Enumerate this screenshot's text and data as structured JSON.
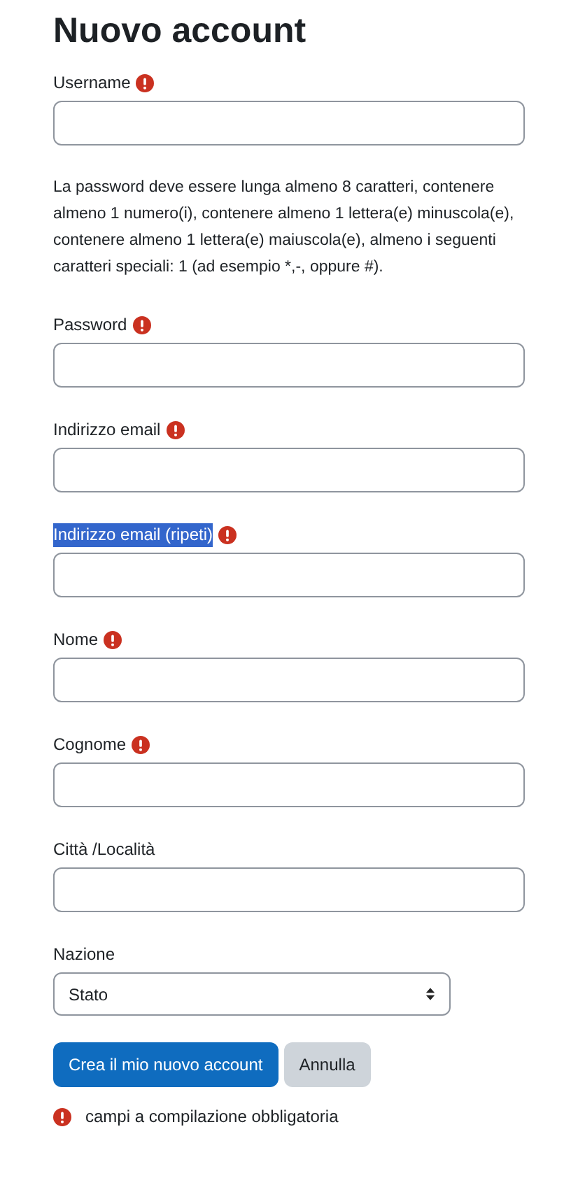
{
  "title": "Nuovo account",
  "fields": [
    {
      "kind": "text",
      "label": "Username",
      "required": true,
      "highlighted": false
    },
    {
      "kind": "note",
      "text": "La password deve essere lunga almeno 8 caratteri, contenere almeno 1 numero(i), contenere almeno 1 lettera(e) minuscola(e), contenere almeno 1 lettera(e) maiuscola(e), almeno i seguenti caratteri speciali: 1 (ad esempio *,-, oppure #)."
    },
    {
      "kind": "text",
      "label": "Password",
      "required": true,
      "highlighted": false
    },
    {
      "kind": "text",
      "label": "Indirizzo email",
      "required": true,
      "highlighted": false
    },
    {
      "kind": "text",
      "label": "Indirizzo email (ripeti)",
      "required": true,
      "highlighted": true
    },
    {
      "kind": "text",
      "label": "Nome",
      "required": true,
      "highlighted": false
    },
    {
      "kind": "text",
      "label": "Cognome",
      "required": true,
      "highlighted": false
    },
    {
      "kind": "text",
      "label": "Città /Località",
      "required": false,
      "highlighted": false
    },
    {
      "kind": "select",
      "label": "Nazione",
      "required": false,
      "highlighted": false,
      "value": "Stato"
    }
  ],
  "buttons": [
    {
      "label": "Crea il mio nuovo account",
      "kind": "primary"
    },
    {
      "label": "Annulla",
      "kind": "secondary"
    }
  ],
  "required_note": "campi a compilazione obbligatoria"
}
